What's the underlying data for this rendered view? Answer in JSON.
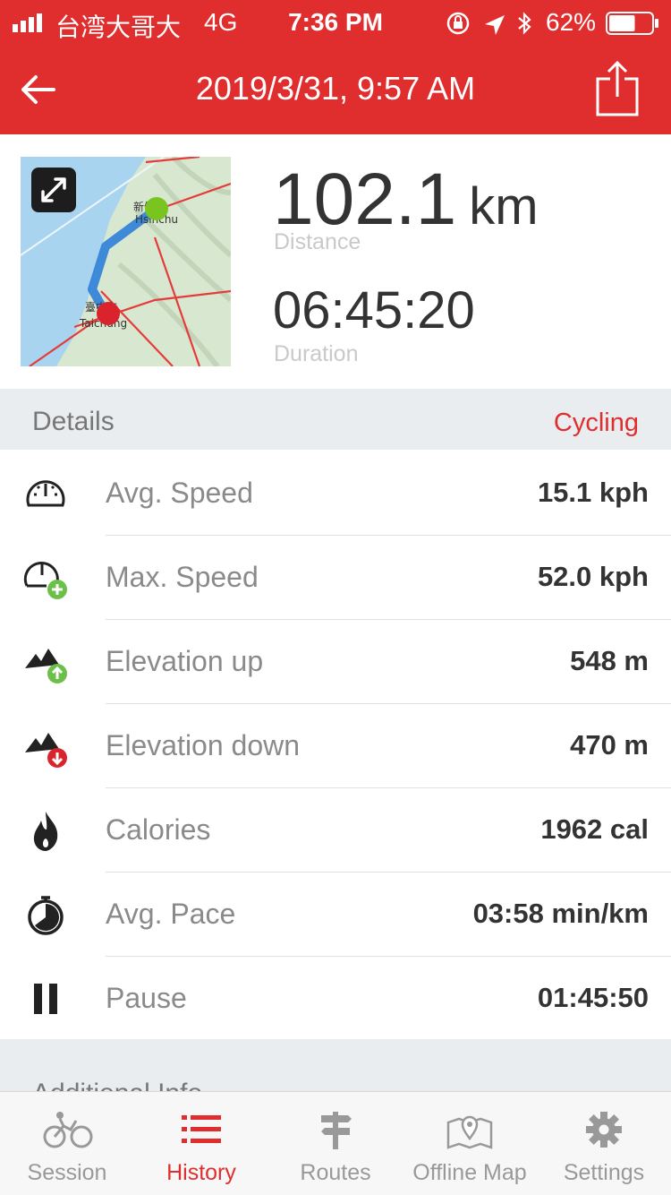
{
  "status_bar": {
    "carrier": "台湾大哥大",
    "network": "4G",
    "time": "7:36 PM",
    "battery": "62%",
    "battery_level": 0.62
  },
  "nav": {
    "title": "2019/3/31, 9:57 AM",
    "back_icon": "arrow-left-icon",
    "share_icon": "share-icon"
  },
  "summary": {
    "distance_value": "102.1",
    "distance_unit": "km",
    "distance_label": "Distance",
    "duration_value": "06:45:20",
    "duration_label": "Duration",
    "map_labels": {
      "start_city_cn": "新竹市",
      "start_city_en": "Hsinchu",
      "end_city_cn": "臺中市",
      "end_city_en": "Taichung"
    }
  },
  "details": {
    "header": "Details",
    "activity_type": "Cycling",
    "rows": [
      {
        "icon": "speedometer-icon",
        "label": "Avg. Speed",
        "value": "15.1 kph"
      },
      {
        "icon": "speedometer-plus-icon",
        "label": "Max. Speed",
        "value": "52.0 kph"
      },
      {
        "icon": "mountain-up-icon",
        "label": "Elevation up",
        "value": "548 m"
      },
      {
        "icon": "mountain-down-icon",
        "label": "Elevation down",
        "value": "470 m"
      },
      {
        "icon": "flame-icon",
        "label": "Calories",
        "value": "1962 cal"
      },
      {
        "icon": "stopwatch-icon",
        "label": "Avg. Pace",
        "value": "03:58 min/km"
      },
      {
        "icon": "pause-icon",
        "label": "Pause",
        "value": "01:45:50"
      }
    ]
  },
  "additional_info": {
    "header": "Additional Info"
  },
  "tabbar": {
    "tabs": [
      {
        "label": "Session",
        "icon": "cyclist-icon",
        "active": false
      },
      {
        "label": "History",
        "icon": "list-icon",
        "active": true
      },
      {
        "label": "Routes",
        "icon": "signpost-icon",
        "active": false
      },
      {
        "label": "Offline Map",
        "icon": "map-pin-icon",
        "active": false
      },
      {
        "label": "Settings",
        "icon": "gear-icon",
        "active": false
      }
    ]
  },
  "colors": {
    "brand_red": "#e02e2e",
    "start_marker": "#7ac41f",
    "end_marker": "#d9232d",
    "route_line": "#2f7fd8"
  }
}
